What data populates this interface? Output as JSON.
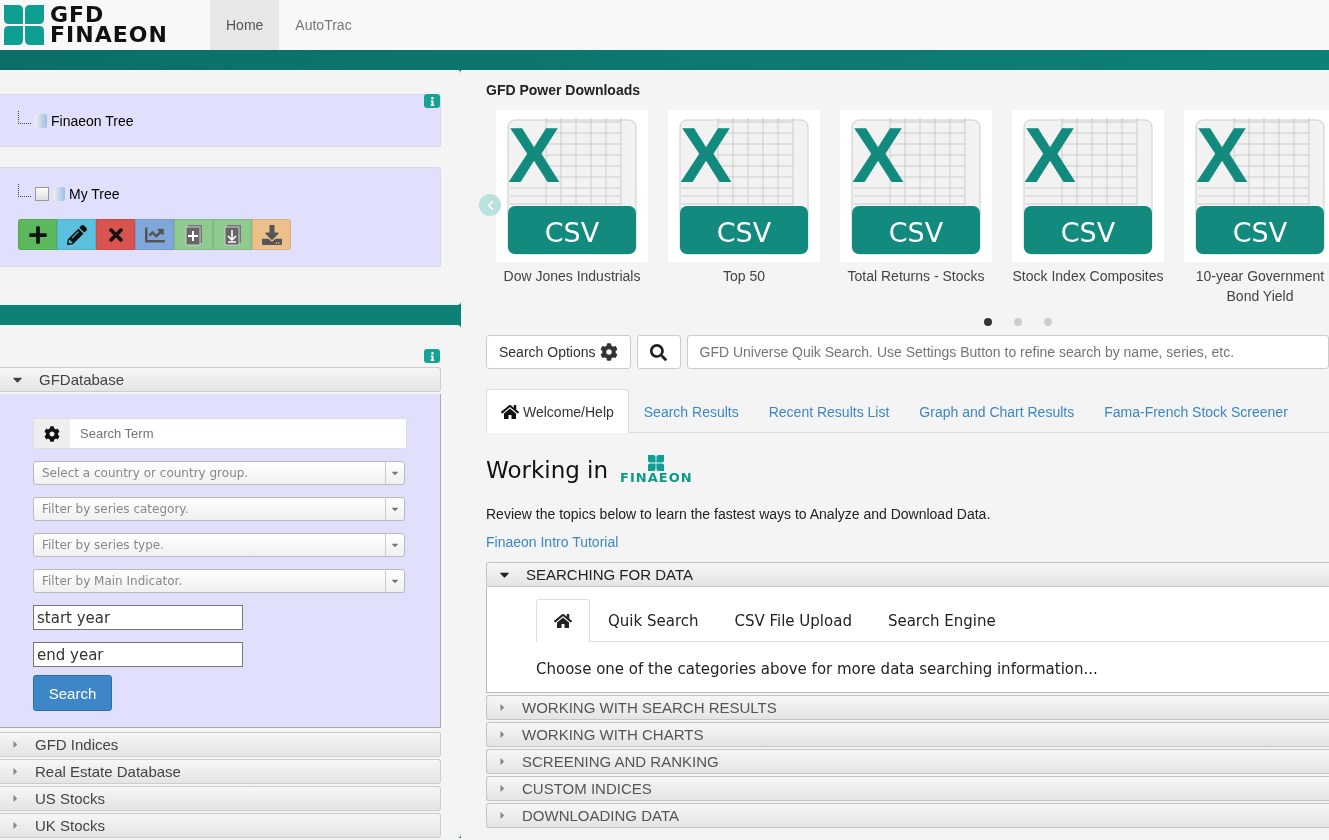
{
  "header": {
    "logo": [
      "GFD",
      "FINAEON"
    ],
    "nav": [
      {
        "label": "Home",
        "selected": true
      },
      {
        "label": "AutoTrac",
        "selected": false
      }
    ]
  },
  "tree_panel": {
    "nodes": [
      {
        "label": "Finaeon Tree",
        "kind": "plain"
      },
      {
        "label": "My Tree",
        "kind": "checkbox",
        "checked": false
      }
    ],
    "toolbar": [
      {
        "kind": "add",
        "color": "#5cb85c"
      },
      {
        "kind": "edit",
        "color": "#5bc0de"
      },
      {
        "kind": "delete",
        "color": "#d9534f"
      },
      {
        "kind": "chart",
        "color": "#7fa7dc"
      },
      {
        "kind": "plus-page",
        "color": "#8fca8f"
      },
      {
        "kind": "import",
        "color": "#8fca8f"
      },
      {
        "kind": "download",
        "color": "#ecc08b"
      }
    ]
  },
  "database_panel": {
    "sections": [
      {
        "label": "GFDatabase",
        "expanded": true
      },
      {
        "label": "GFD Indices",
        "expanded": false
      },
      {
        "label": "Real Estate Database",
        "expanded": false
      },
      {
        "label": "US Stocks",
        "expanded": false
      },
      {
        "label": "UK Stocks",
        "expanded": false
      }
    ],
    "search_term": {
      "placeholder": "Search Term"
    },
    "selects": [
      {
        "placeholder": "Select a country or country group."
      },
      {
        "placeholder": "Filter by series category."
      },
      {
        "placeholder": "Filter by series type."
      },
      {
        "placeholder": "Filter by Main Indicator."
      }
    ],
    "start_year": {
      "value": "start year"
    },
    "end_year": {
      "value": "end year"
    },
    "search_button": "Search"
  },
  "downloads": {
    "title": "GFD Power Downloads",
    "items": [
      {
        "label": "Dow Jones Industrials",
        "letter": "X",
        "badge": "CSV"
      },
      {
        "label": "Top 50",
        "letter": "X",
        "badge": "CSV"
      },
      {
        "label": "Total Returns - Stocks",
        "letter": "X",
        "badge": "CSV"
      },
      {
        "label": "Stock Index Composites",
        "letter": "X",
        "badge": "CSV"
      },
      {
        "label": "10-year Government Bond Yield",
        "letter": "X",
        "badge": "CSV"
      }
    ],
    "dots": [
      {
        "selected": true
      },
      {
        "selected": false
      },
      {
        "selected": false
      }
    ]
  },
  "quick_search": {
    "options_button": "Search Options",
    "placeholder": "GFD Universe Quik Search. Use Settings Button to refine search by name, series, etc."
  },
  "tabs": [
    {
      "label": "Welcome/Help",
      "selected": true,
      "kind": "home"
    },
    {
      "label": "Search Results",
      "selected": false,
      "kind": "text"
    },
    {
      "label": "Recent Results List",
      "selected": false,
      "kind": "text"
    },
    {
      "label": "Graph and Chart Results",
      "selected": false,
      "kind": "text"
    },
    {
      "label": "Fama-French Stock Screener",
      "selected": false,
      "kind": "text"
    }
  ],
  "welcome": {
    "heading": "Working in",
    "heading_logo": "FINAEON",
    "intro": "Review the topics below to learn the fastest ways to Analyze and Download Data.",
    "link": "Finaeon Intro Tutorial",
    "topics": [
      {
        "label": "SEARCHING FOR DATA",
        "expanded": true
      },
      {
        "label": "WORKING WITH SEARCH RESULTS",
        "expanded": false
      },
      {
        "label": "WORKING WITH CHARTS",
        "expanded": false
      },
      {
        "label": "SCREENING AND RANKING",
        "expanded": false
      },
      {
        "label": "CUSTOM INDICES",
        "expanded": false
      },
      {
        "label": "DOWNLOADING DATA",
        "expanded": false
      }
    ],
    "subtabs": [
      {
        "kind": "home",
        "selected": true
      },
      {
        "kind": "text",
        "label": "Quik Search",
        "selected": false
      },
      {
        "kind": "text",
        "label": "CSV File Upload",
        "selected": false
      },
      {
        "kind": "text",
        "label": "Search Engine",
        "selected": false
      }
    ],
    "subtab_text": "Choose one of the categories above for more data searching information..."
  }
}
